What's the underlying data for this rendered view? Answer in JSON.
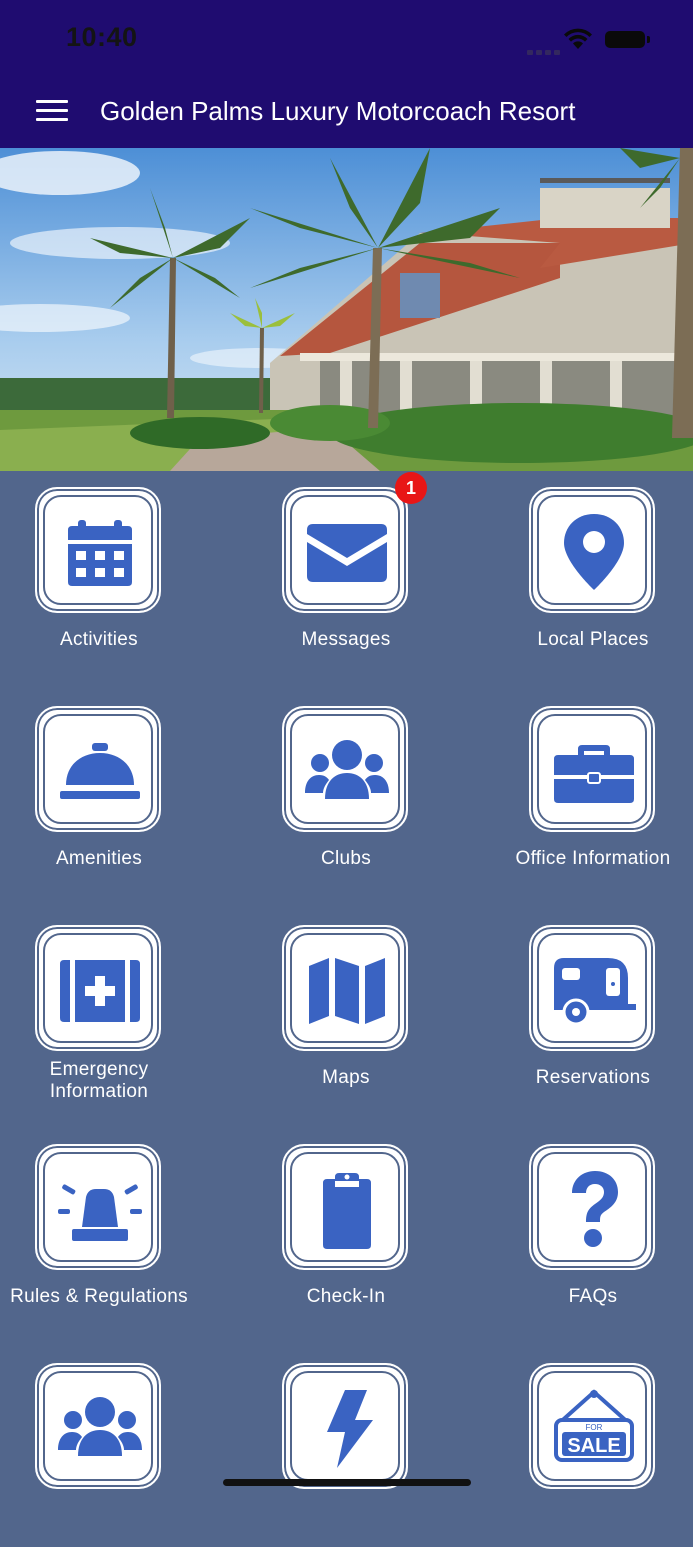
{
  "status_bar": {
    "time": "10:40"
  },
  "header": {
    "title": "Golden Palms Luxury Motorcoach Resort"
  },
  "tiles": [
    {
      "label": "Activities",
      "icon": "calendar-icon"
    },
    {
      "label": "Messages",
      "icon": "envelope-icon",
      "badge": "1"
    },
    {
      "label": "Local Places",
      "icon": "map-pin-icon"
    },
    {
      "label": "Amenities",
      "icon": "service-bell-icon"
    },
    {
      "label": "Clubs",
      "icon": "users-icon"
    },
    {
      "label": "Office Information",
      "icon": "briefcase-icon"
    },
    {
      "label": "Emergency\nInformation",
      "icon": "medical-kit-icon"
    },
    {
      "label": "Maps",
      "icon": "folded-map-icon"
    },
    {
      "label": "Reservations",
      "icon": "camper-trailer-icon"
    },
    {
      "label": "Rules & Regulations",
      "icon": "siren-icon"
    },
    {
      "label": "Check-In",
      "icon": "clipboard-icon"
    },
    {
      "label": "FAQs",
      "icon": "question-mark-icon"
    },
    {
      "label": "",
      "icon": "users-icon"
    },
    {
      "label": "",
      "icon": "lightning-bolt-icon"
    },
    {
      "label": "",
      "icon": "for-sale-sign-icon",
      "sign_small": "FOR",
      "sign_big": "SALE"
    }
  ],
  "colors": {
    "header": "#1f0c70",
    "background": "#52668c",
    "icon": "#3a63c2",
    "badge": "#e81616"
  }
}
